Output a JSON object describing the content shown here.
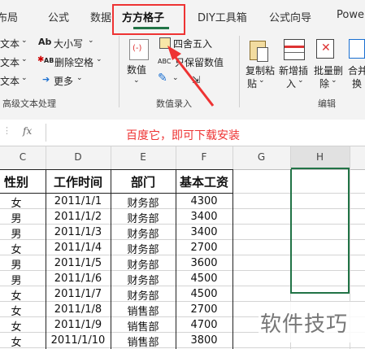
{
  "tabs": [
    {
      "label": "布局",
      "active": false
    },
    {
      "label": "公式",
      "active": false
    },
    {
      "label": "数据",
      "active": false
    },
    {
      "label": "方方格子",
      "active": true
    },
    {
      "label": "DIY工具箱",
      "active": false
    },
    {
      "label": "公式向导",
      "active": false
    },
    {
      "label": "Power",
      "active": false
    }
  ],
  "ribbon": {
    "text_group": {
      "left_items": [
        "文本",
        "文本",
        "文本"
      ],
      "case_label": "大小写",
      "remove_space_label": "删除空格",
      "more_label": "更多",
      "group_label": "高级文本处理"
    },
    "numeric_group": {
      "numeric_label": "数值",
      "round_label": "四舍五入",
      "keep_value_label": "只保留数值",
      "group_label": "数值录入"
    },
    "edit_group": {
      "copy_paste_label": [
        "复制粘",
        "贴"
      ],
      "insert_label": [
        "新增插",
        "入"
      ],
      "batch_delete_label": [
        "批量删",
        "除"
      ],
      "merge_label": [
        "合并",
        "换"
      ],
      "group_label": "编辑"
    }
  },
  "formula_bar": {
    "fx_label": "fx",
    "content": "百度它，即可下载安装"
  },
  "grid": {
    "columns": [
      "C",
      "D",
      "E",
      "F",
      "G",
      "H"
    ],
    "selected_column": "H",
    "header_row": [
      "性别",
      "工作时间",
      "部门",
      "基本工资"
    ],
    "rows": [
      [
        "女",
        "2011/1/1",
        "财务部",
        "4300"
      ],
      [
        "男",
        "2011/1/2",
        "财务部",
        "3400"
      ],
      [
        "男",
        "2011/1/3",
        "财务部",
        "3400"
      ],
      [
        "女",
        "2011/1/4",
        "财务部",
        "2700"
      ],
      [
        "男",
        "2011/1/5",
        "财务部",
        "3600"
      ],
      [
        "男",
        "2011/1/6",
        "财务部",
        "4500"
      ],
      [
        "女",
        "2011/1/7",
        "财务部",
        "4500"
      ],
      [
        "女",
        "2011/1/8",
        "销售部",
        "2700"
      ],
      [
        "女",
        "2011/1/9",
        "销售部",
        "4700"
      ],
      [
        "女",
        "2011/1/10",
        "销售部",
        "3800"
      ]
    ]
  },
  "watermark": "软件技巧",
  "colors": {
    "accent": "#217346",
    "annotation": "#e33333",
    "selection": "#217346"
  }
}
